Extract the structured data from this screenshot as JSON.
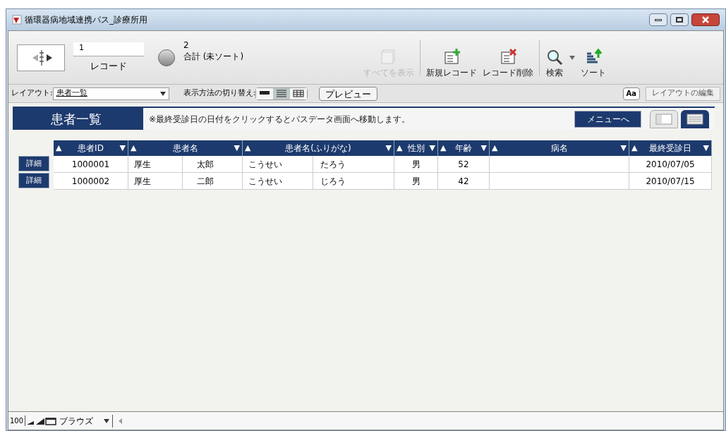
{
  "window": {
    "title": "循環器病地域連携パス_診療所用"
  },
  "toolbar": {
    "record_number": "1",
    "record_label": "レコード",
    "total": "2",
    "total_label": "合計 (未ソート)",
    "buttons": [
      {
        "kind": "show-all",
        "label": "すべてを表示",
        "disabled": true
      },
      {
        "kind": "new",
        "label": "新規レコード",
        "disabled": false
      },
      {
        "kind": "delete",
        "label": "レコード削除",
        "disabled": false
      },
      {
        "kind": "search",
        "label": "検索",
        "disabled": false
      },
      {
        "kind": "sort",
        "label": "ソート",
        "disabled": false
      }
    ]
  },
  "layout_bar": {
    "layout_label": "レイアウト:",
    "layout_value": "患者一覧",
    "view_label": "表示方法の切り替え:",
    "views": [
      {
        "kind": "form",
        "selected": false
      },
      {
        "kind": "list",
        "selected": true
      },
      {
        "kind": "table",
        "selected": false
      }
    ],
    "preview": "プレビュー",
    "font_button": "Aa",
    "edit_layout": "レイアウトの編集"
  },
  "header": {
    "title": "患者一覧",
    "note": "※最終受診日の日付をクリックするとパスデータ画面へ移動します。",
    "menu_button": "メニューへ",
    "views": [
      {
        "kind": "form",
        "selected": false
      },
      {
        "kind": "list",
        "selected": true
      }
    ]
  },
  "table": {
    "columns": [
      {
        "label": "患者ID",
        "up": "▲",
        "down": "▼"
      },
      {
        "label": "患者名",
        "up": "▲",
        "down": "▼"
      },
      {
        "label": "患者名(ふりがな)",
        "up": "▲",
        "down": "▼"
      },
      {
        "label": "性別",
        "up": "▲",
        "down": "▼"
      },
      {
        "label": "年齢",
        "up": "▲",
        "down": "▼"
      },
      {
        "label": "病名",
        "up": "▲",
        "down": "▼"
      },
      {
        "label": "最終受診日",
        "up": "▲",
        "down": "▼"
      }
    ],
    "rows": [
      {
        "detail": "詳細",
        "id": "1000001",
        "surname": "厚生",
        "given_name": "太郎",
        "kana_surname": "こうせい",
        "kana_given": "たろう",
        "sex": "男",
        "age": "52",
        "last_visit": "2010/07/05"
      },
      {
        "detail": "詳細",
        "id": "1000002",
        "surname": "厚生",
        "given_name": "二郎",
        "kana_surname": "こうせい",
        "kana_given": "じろう",
        "sex": "男",
        "age": "42",
        "last_visit": "2010/07/15"
      }
    ]
  },
  "status_bar": {
    "zoom": "100",
    "mode": "ブラウズ"
  }
}
